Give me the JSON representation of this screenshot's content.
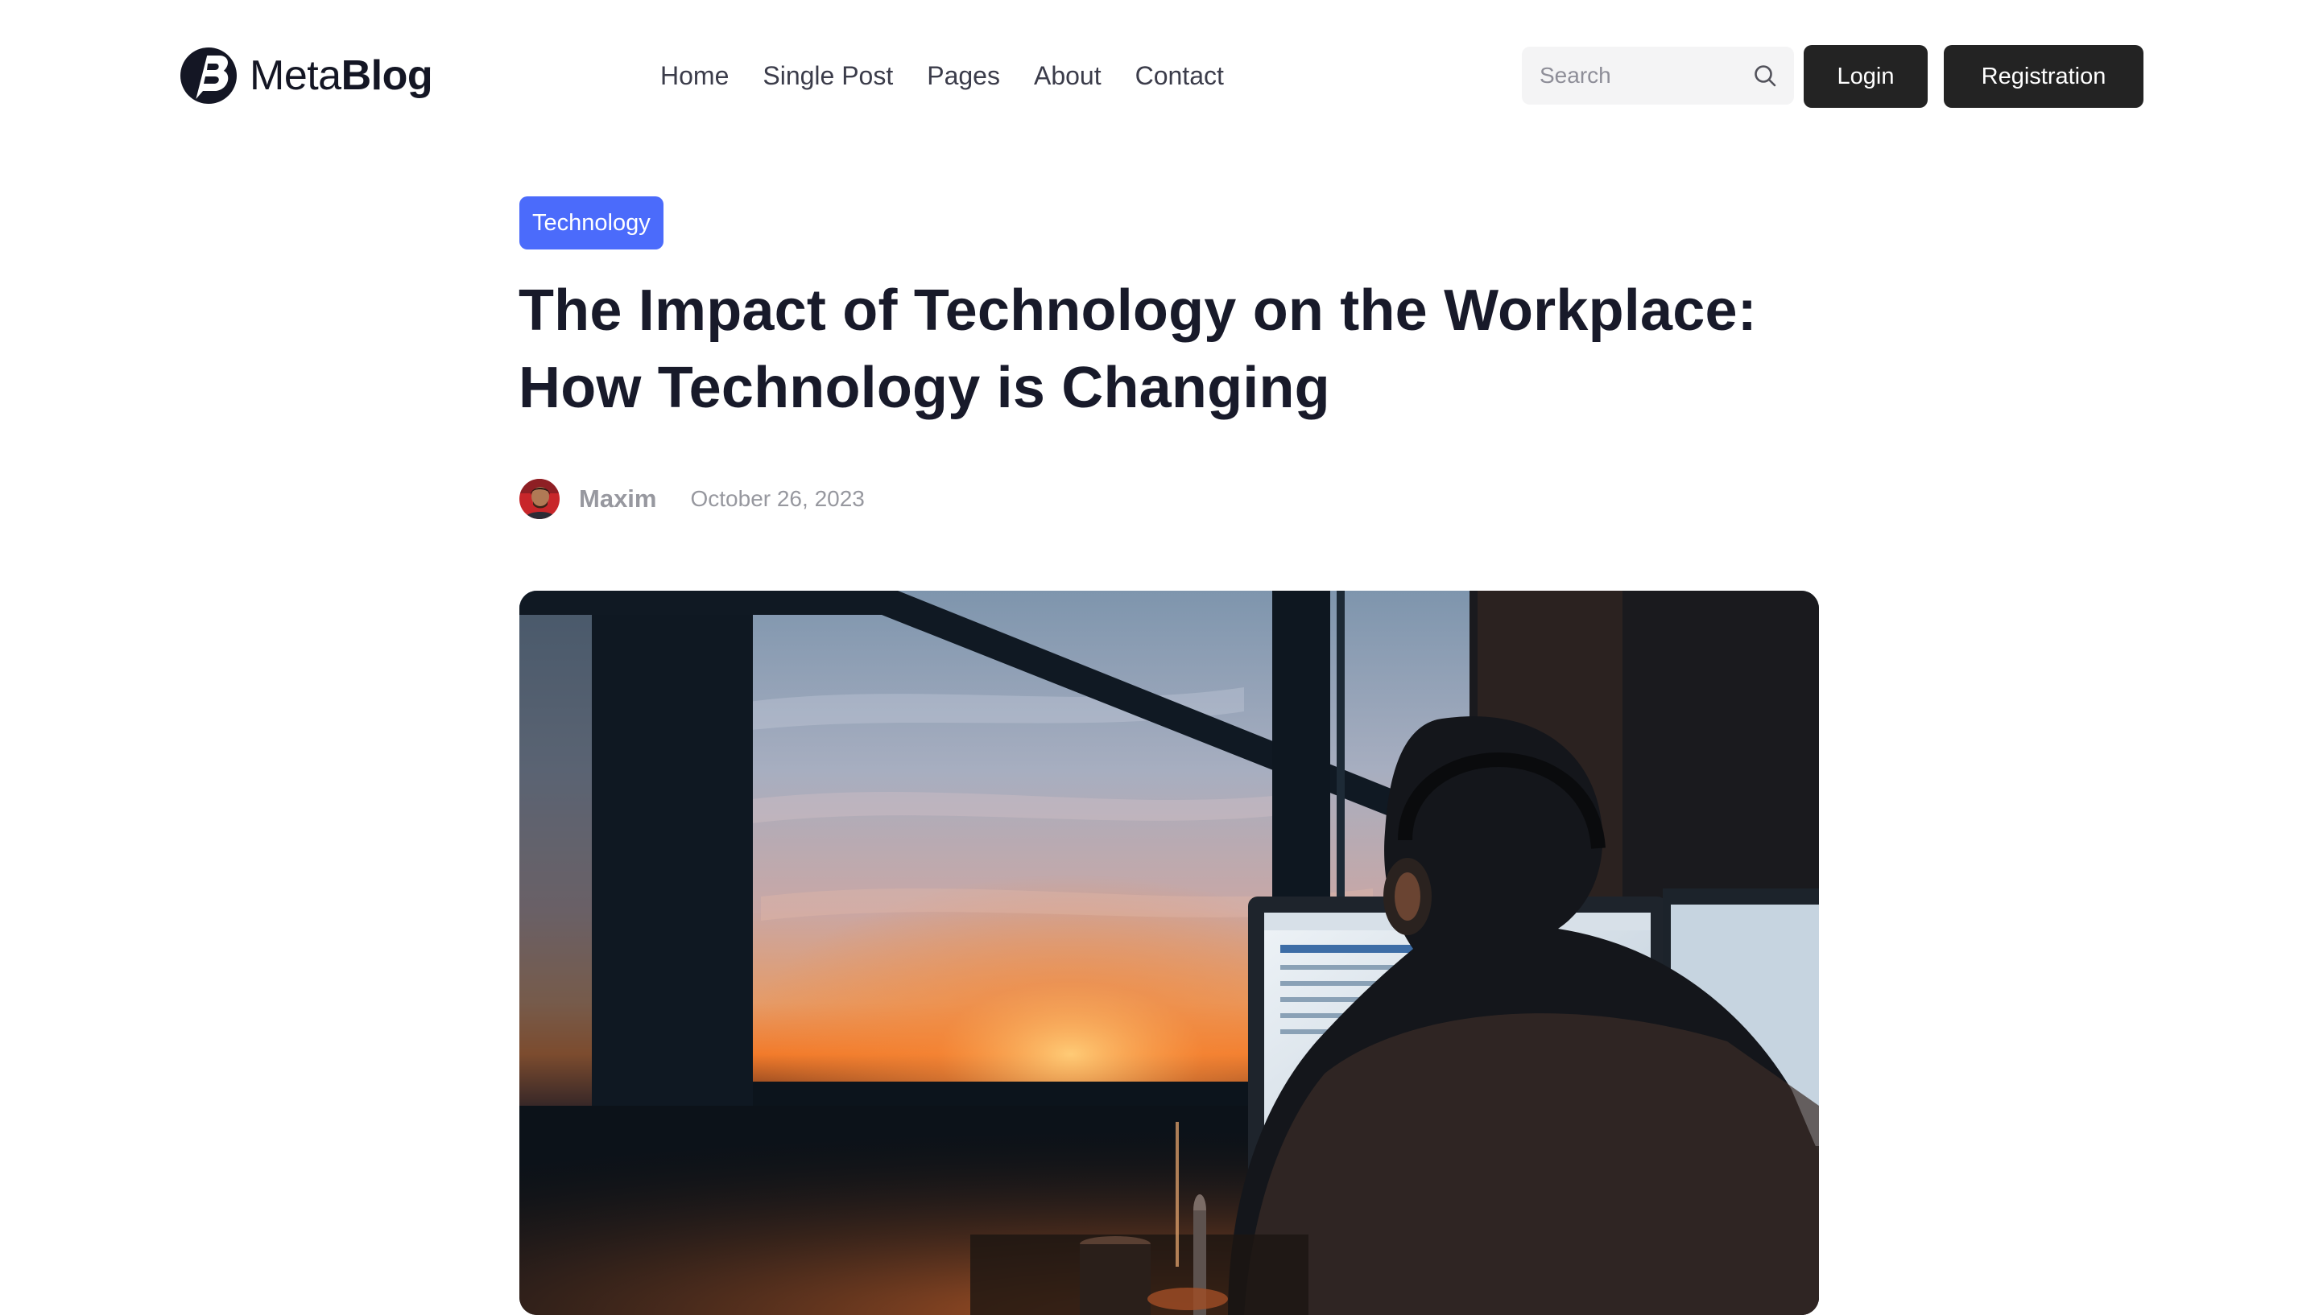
{
  "brand": {
    "name_light": "Meta",
    "name_bold": "Blog",
    "logo_icon": "b-logo-icon"
  },
  "nav": {
    "items": [
      {
        "label": "Home"
      },
      {
        "label": "Single Post"
      },
      {
        "label": "Pages"
      },
      {
        "label": "About"
      },
      {
        "label": "Contact"
      }
    ]
  },
  "search": {
    "placeholder": "Search",
    "value": "",
    "icon": "search-icon"
  },
  "auth": {
    "login_label": "Login",
    "register_label": "Registration"
  },
  "article": {
    "category": "Technology",
    "title": "The Impact of Technology on the Workplace: How Technology is Changing",
    "author": "Maxim",
    "date": "October 26, 2023",
    "hero_image": "photo of a person with headphones working at a computer in front of a window at sunset"
  },
  "colors": {
    "accent": "#4b6bfb",
    "button_bg": "#232323",
    "title_text": "#181a2a",
    "muted_text": "#97989f",
    "search_bg": "#f4f4f5"
  }
}
